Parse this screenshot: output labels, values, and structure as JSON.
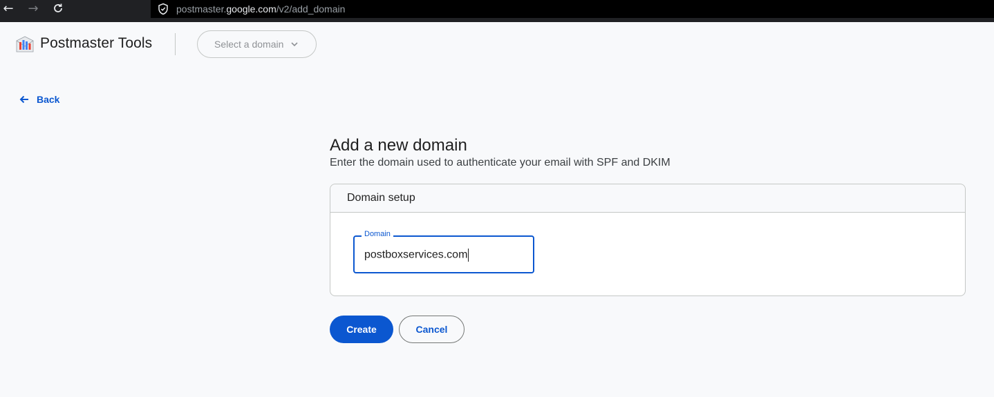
{
  "browser": {
    "url_prefix": "postmaster.",
    "url_domain": "google.com",
    "url_path": "/v2/add_domain"
  },
  "header": {
    "app_title": "Postmaster Tools",
    "domain_select_placeholder": "Select a domain"
  },
  "nav": {
    "back_label": "Back"
  },
  "main": {
    "title": "Add a new domain",
    "subtitle": "Enter the domain used to authenticate your email with SPF and DKIM",
    "card_title": "Domain setup",
    "domain_field_label": "Domain",
    "domain_field_value": "postboxservices.com"
  },
  "actions": {
    "create_label": "Create",
    "cancel_label": "Cancel"
  },
  "colors": {
    "accent": "#0b57d0",
    "background": "#f8f9fb",
    "chrome": "#202124"
  }
}
